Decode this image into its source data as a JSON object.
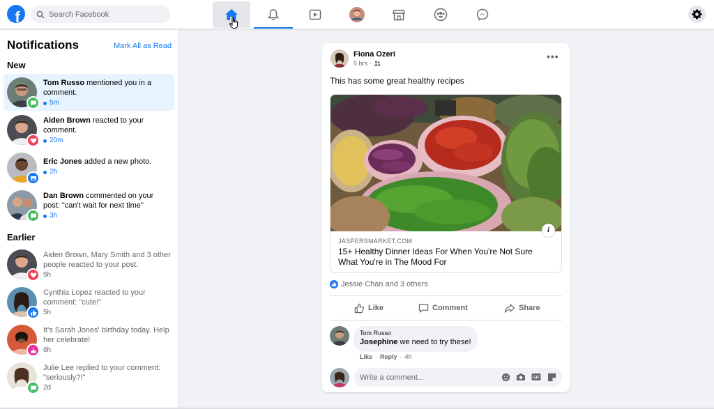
{
  "app": {
    "logo_letter": "f"
  },
  "search": {
    "placeholder": "Search Facebook"
  },
  "nav": [
    {
      "name": "home",
      "icon": "home-icon",
      "active": true
    },
    {
      "name": "notifications",
      "icon": "bell-icon"
    },
    {
      "name": "watch",
      "icon": "video-icon"
    },
    {
      "name": "profile",
      "icon": "avatar"
    },
    {
      "name": "marketplace",
      "icon": "store-icon"
    },
    {
      "name": "groups",
      "icon": "groups-icon"
    },
    {
      "name": "messenger",
      "icon": "messenger-icon"
    }
  ],
  "sidebar": {
    "title": "Notifications",
    "mark_all": "Mark All as Read",
    "new_label": "New",
    "earlier_label": "Earlier",
    "new_items": [
      {
        "name": "Tom Russo",
        "text": " mentioned you in a comment.",
        "time": "5m",
        "badge": "comment",
        "unread": true
      },
      {
        "name": "Aiden Brown",
        "text": " reacted to your comment.",
        "time": "20m",
        "badge": "love",
        "unread": true
      },
      {
        "name": "Eric Jones",
        "text": " added a new photo.",
        "time": "2h",
        "badge": "photo",
        "unread": true
      },
      {
        "name": "Dan Brown",
        "text": " commented on your post: \"can't wait for next time\"",
        "time": "3h",
        "badge": "comment",
        "unread": true
      }
    ],
    "earlier_items": [
      {
        "name": "Aiden Brown, Mary Smith",
        "text": " and 3 other people reacted to your post.",
        "time": "5h",
        "badge": "love"
      },
      {
        "name": "Cynthia Lopez",
        "text": " reacted to your comment: \"cute!\"",
        "time": "5h",
        "badge": "like"
      },
      {
        "pre": "It's ",
        "name": "Sarah Jones",
        "text": "' birthday today. Help her celebrate!",
        "time": "6h",
        "badge": "birthday"
      },
      {
        "name": "Julie Lee",
        "text": " replied to your comment: \"seriously?!\"",
        "time": "2d",
        "badge": "comment"
      }
    ]
  },
  "post": {
    "author": "Fiona Ozeri",
    "time": "5 hrs",
    "text": "This has some great healthy recipes",
    "link_domain": "JASPERSMARKET.COM",
    "link_title": "15+ Healthy Dinner Ideas For When You're Not Sure What You're in The Mood For",
    "reactions": "Jessie Chan and 3 others",
    "actions": {
      "like": "Like",
      "comment": "Comment",
      "share": "Share"
    },
    "comment": {
      "author": "Tom Russo",
      "mention": "Josephine",
      "body": " we need to try these!",
      "like": "Like",
      "reply": "Reply",
      "time": "4h"
    },
    "write_placeholder": "Write a comment..."
  },
  "colors": {
    "accent": "#1877f2",
    "love": "#f33e58",
    "comment": "#45bd62",
    "birthday": "#e42f9a"
  }
}
